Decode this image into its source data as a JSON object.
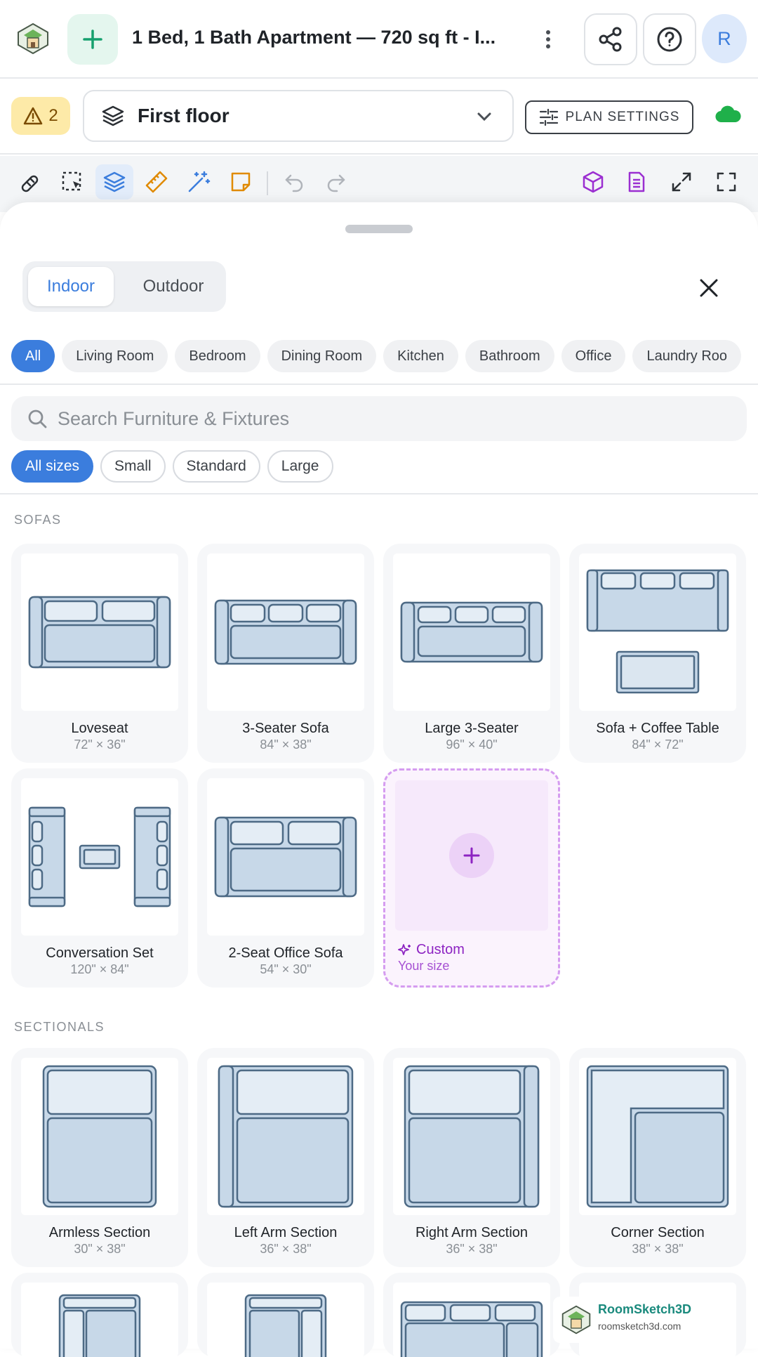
{
  "header": {
    "title": "1 Bed, 1 Bath Apartment — 720 sq ft - I...",
    "avatar_initial": "R"
  },
  "floorbar": {
    "warning_count": "2",
    "floor_label": "First floor",
    "plan_settings_label": "PLAN SETTINGS"
  },
  "colors": {
    "accent": "#3b7ddd",
    "add_green": "#16a06e",
    "warning": "#fdeaa8",
    "custom_purple": "#8d24c2",
    "cloud": "#1fb04a"
  },
  "sheet": {
    "tabs": [
      {
        "label": "Indoor"
      },
      {
        "label": "Outdoor"
      }
    ],
    "categories": [
      "All",
      "Living Room",
      "Bedroom",
      "Dining Room",
      "Kitchen",
      "Bathroom",
      "Office",
      "Laundry Roo"
    ],
    "search_placeholder": "Search Furniture & Fixtures",
    "sizes": [
      "All sizes",
      "Small",
      "Standard",
      "Large"
    ],
    "sections": {
      "sofas_title": "SOFAS",
      "sofas": [
        {
          "name": "Loveseat",
          "dim": "72\" × 36\""
        },
        {
          "name": "3-Seater Sofa",
          "dim": "84\" × 38\""
        },
        {
          "name": "Large 3-Seater",
          "dim": "96\" × 40\""
        },
        {
          "name": "Sofa + Coffee Table",
          "dim": "84\" × 72\""
        },
        {
          "name": "Conversation Set",
          "dim": "120\" × 84\""
        },
        {
          "name": "2-Seat Office Sofa",
          "dim": "54\" × 30\""
        }
      ],
      "custom": {
        "name": "Custom",
        "dim": "Your size"
      },
      "sectionals_title": "SECTIONALS",
      "sectionals": [
        {
          "name": "Armless Section",
          "dim": "30\" × 38\""
        },
        {
          "name": "Left Arm Section",
          "dim": "36\" × 38\""
        },
        {
          "name": "Right Arm Section",
          "dim": "36\" × 38\""
        },
        {
          "name": "Corner Section",
          "dim": "38\" × 38\""
        }
      ]
    }
  },
  "watermark": {
    "title": "RoomSketch3D",
    "url": "roomsketch3d.com"
  }
}
